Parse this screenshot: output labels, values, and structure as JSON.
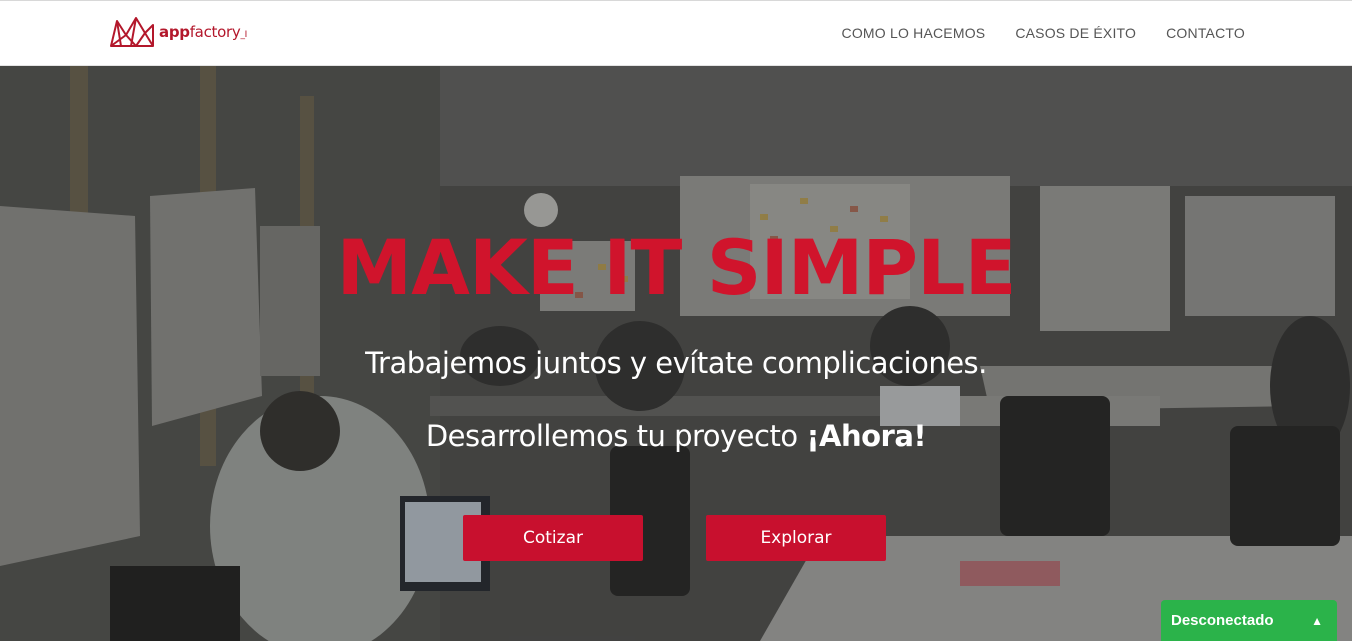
{
  "brand": {
    "app": "app",
    "factory": "factory",
    "tail": "_I",
    "color": "#b3172b"
  },
  "nav": {
    "items": [
      "COMO LO HACEMOS",
      "CASOS DE ÉXITO",
      "CONTACTO"
    ]
  },
  "hero": {
    "headline": "MAKE IT SIMPLE",
    "subtitle": "Trabajemos juntos y evítate complicaciones.",
    "subtitle2_prefix": "Desarrollemos tu proyecto ",
    "subtitle2_strong": "¡Ahora!",
    "accent_color": "#d0142c"
  },
  "buttons": {
    "cotizar": "Cotizar",
    "explorar": "Explorar"
  },
  "chat": {
    "status": "Desconectado",
    "icon": "chevron-up-icon",
    "color": "#2bb34a"
  }
}
